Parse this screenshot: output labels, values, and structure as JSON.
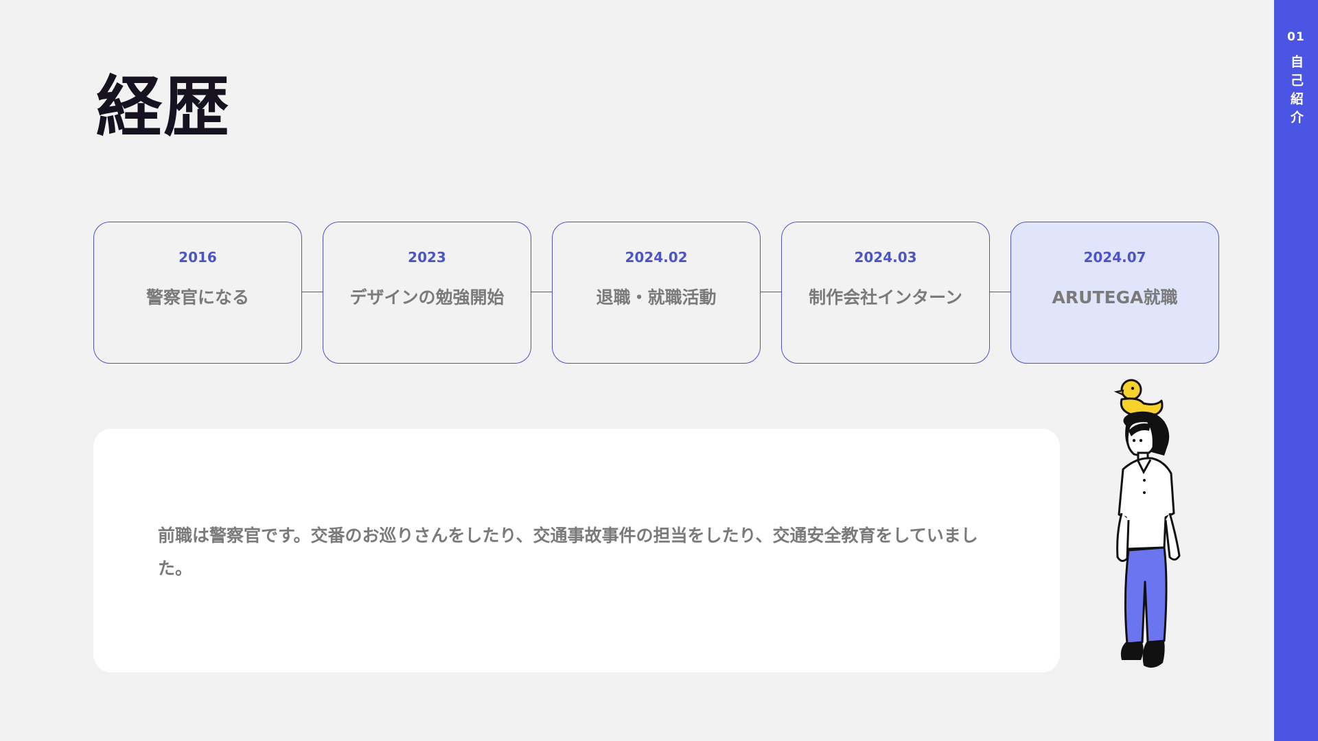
{
  "title": "経歴",
  "side_nav": {
    "number": "01",
    "label": "自己紹介"
  },
  "timeline": [
    {
      "year": "2016",
      "label": "警察官になる"
    },
    {
      "year": "2023",
      "label": "デザインの勉強開始"
    },
    {
      "year": "2024.02",
      "label": "退職・就職活動"
    },
    {
      "year": "2024.03",
      "label": "制作会社インターン"
    },
    {
      "year": "2024.07",
      "label": "ARUTEGA就職",
      "active": true
    }
  ],
  "description": "前職は警察官です。交番のお巡りさんをしたり、交通事故事件の担当をしたり、交通安全教育をしていました。",
  "colors": {
    "accent": "#4b55e3",
    "active_card": "#e1e5fb",
    "duck": "#f7d22a",
    "pants": "#6b75f0"
  }
}
